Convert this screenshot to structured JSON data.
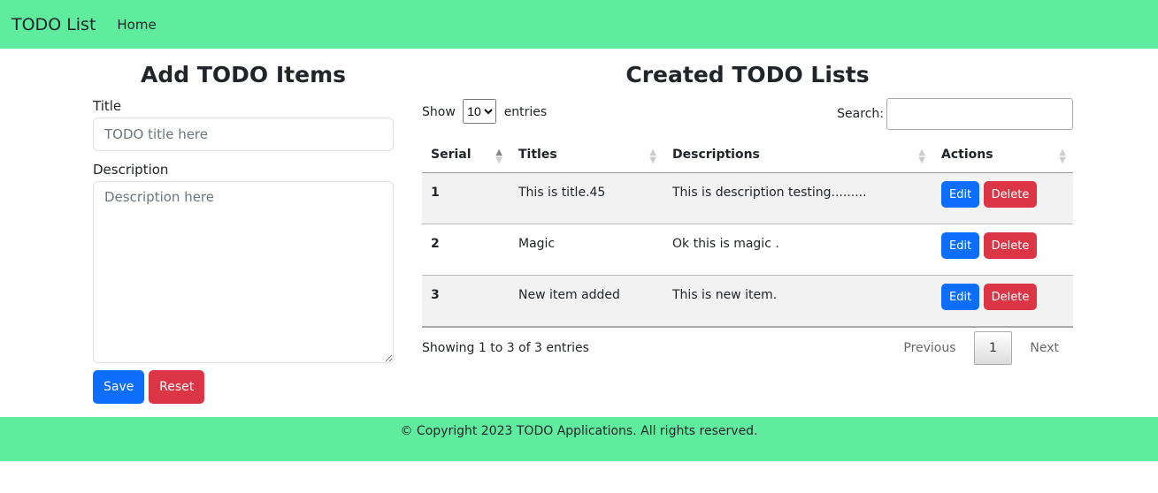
{
  "nav": {
    "brand": "TODO List",
    "home": "Home"
  },
  "form": {
    "heading": "Add TODO Items",
    "title_label": "Title",
    "title_placeholder": "TODO title here",
    "desc_label": "Description",
    "desc_placeholder": "Description here",
    "save": "Save",
    "reset": "Reset"
  },
  "list": {
    "heading": "Created TODO Lists",
    "show": "Show",
    "entries_value": "10",
    "entries": "entries",
    "search_label": "Search:",
    "columns": [
      "Serial",
      "Titles",
      "Descriptions",
      "Actions"
    ],
    "rows": [
      {
        "serial": "1",
        "title": "This is title.45",
        "description": "This is description testing........."
      },
      {
        "serial": "2",
        "title": "Magic",
        "description": "Ok this is magic ."
      },
      {
        "serial": "3",
        "title": "New item added",
        "description": "This is new item."
      }
    ],
    "edit": "Edit",
    "delete": "Delete",
    "info": "Showing 1 to 3 of 3 entries",
    "previous": "Previous",
    "page": "1",
    "next": "Next"
  },
  "footer": {
    "text": "© Copyright 2023 TODO Applications. All rights reserved."
  },
  "colors": {
    "nav_bg": "#5fec9e",
    "primary": "#0d6efd",
    "danger": "#dc3545"
  }
}
